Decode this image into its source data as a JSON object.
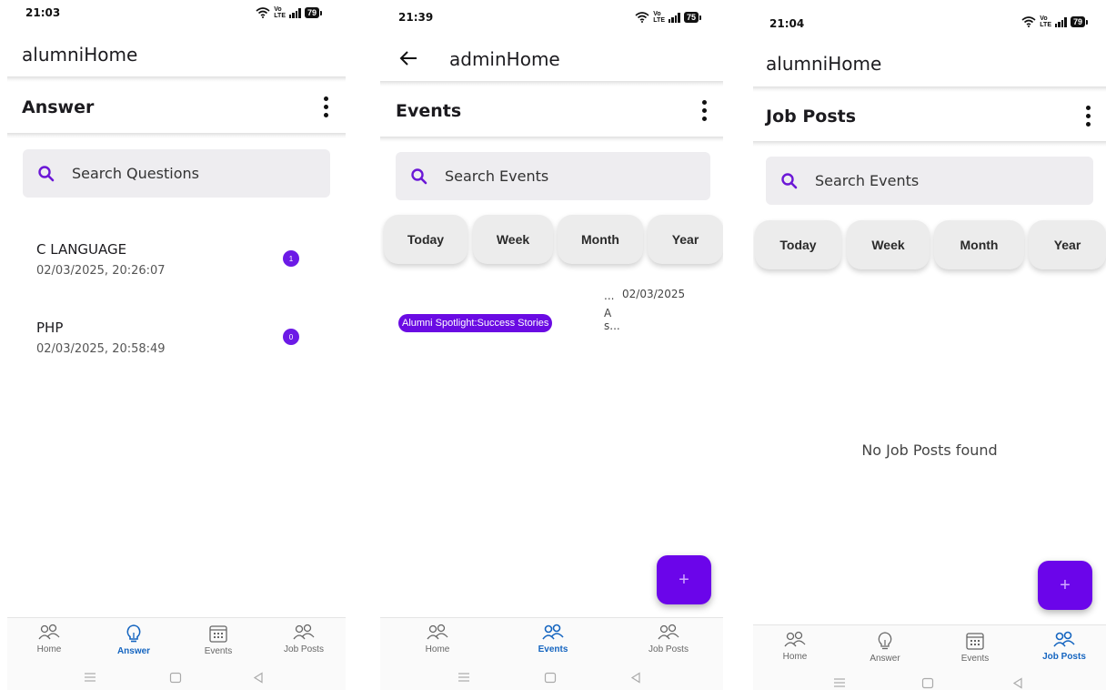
{
  "screens": [
    {
      "status": {
        "time": "21:03",
        "battery": "79"
      },
      "app_title": "alumniHome",
      "section_title": "Answer",
      "search_placeholder": "Search Questions",
      "questions": [
        {
          "title": "C LANGUAGE",
          "timestamp": "02/03/2025, 20:26:07",
          "count": "1"
        },
        {
          "title": "PHP",
          "timestamp": "02/03/2025, 20:58:49",
          "count": "0"
        }
      ],
      "nav": [
        "Home",
        "Answer",
        "Events",
        "Job Posts"
      ],
      "active_nav": "Answer"
    },
    {
      "status": {
        "time": "21:39",
        "battery": "75"
      },
      "app_title": "adminHome",
      "section_title": "Events",
      "search_placeholder": "Search Events",
      "filters": [
        "Today",
        "Week",
        "Month",
        "Year"
      ],
      "event": {
        "tag": "Alumni Spotlight:Success Stories",
        "ellipsis": "...",
        "date": "02/03/2025",
        "line1": "A",
        "line2": "s..."
      },
      "fab_label": "+",
      "nav": [
        "Home",
        "Events",
        "Job Posts"
      ],
      "active_nav": "Events"
    },
    {
      "status": {
        "time": "21:04",
        "battery": "79"
      },
      "app_title": "alumniHome",
      "section_title": "Job Posts",
      "search_placeholder": "Search Events",
      "filters": [
        "Today",
        "Week",
        "Month",
        "Year"
      ],
      "empty_message": "No Job Posts found",
      "fab_label": "+",
      "nav": [
        "Home",
        "Answer",
        "Events",
        "Job Posts"
      ],
      "active_nav": "Job Posts"
    }
  ],
  "status_icons": {
    "lte_top": "Vo",
    "lte_bottom": "LTE"
  },
  "colors": {
    "accent": "#6a0be3",
    "nav_active": "#1565c0",
    "search_bg": "#eeedf0"
  }
}
